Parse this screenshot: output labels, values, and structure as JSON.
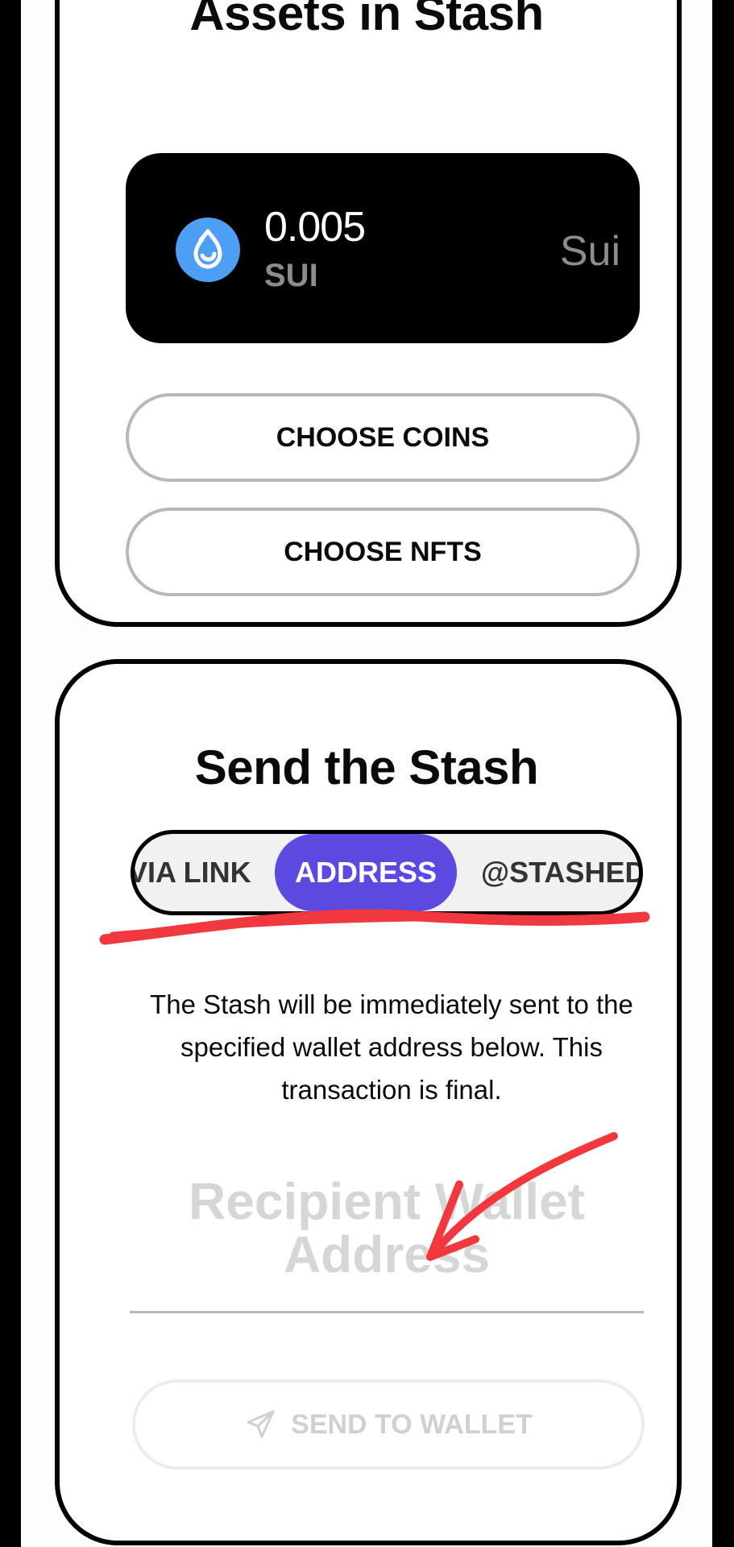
{
  "colors": {
    "accent": "#5c49e0",
    "annotation": "#f0383e",
    "coin_icon": "#4d9ff5",
    "coin_tile": "#000000",
    "muted_text": "#8c8c8c"
  },
  "assets_card": {
    "title": "Assets in Stash",
    "coin": {
      "icon": "sui-drop-icon",
      "amount": "0.005",
      "symbol": "SUI",
      "network": "Sui"
    },
    "choose_coins_label": "CHOOSE COINS",
    "choose_nfts_label": "CHOOSE NFTS"
  },
  "send_card": {
    "title": "Send the Stash",
    "tabs": [
      {
        "label": "VIA LINK",
        "selected": false
      },
      {
        "label": "ADDRESS",
        "selected": true
      },
      {
        "label": "@STASHED",
        "selected": false
      }
    ],
    "description": "The Stash will be immediately sent to the specified wallet address below. This transaction is final.",
    "wallet_input": {
      "placeholder": "Recipient Wallet Address",
      "value": ""
    },
    "send_button": {
      "icon": "paper-plane-icon",
      "label": "SEND TO WALLET",
      "enabled": false
    }
  },
  "annotations": [
    {
      "type": "underline-scribble",
      "target": "tabs",
      "color": "#f0383e"
    },
    {
      "type": "arrow",
      "target": "wallet-input",
      "color": "#f0383e"
    }
  ]
}
